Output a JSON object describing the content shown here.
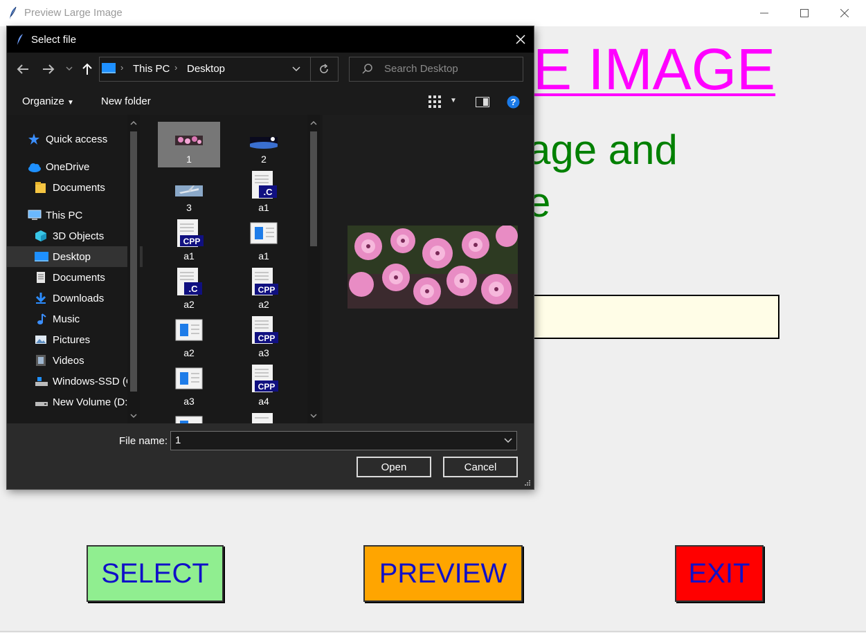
{
  "window": {
    "title": "Preview Large Image"
  },
  "main": {
    "heading": "E IMAGE",
    "subtitle_line1": "age and",
    "subtitle_line2": "e",
    "buttons": {
      "select": "SELECT",
      "preview": "PREVIEW",
      "exit": "EXIT"
    },
    "colors": {
      "heading": "#ff00ff",
      "subtitle": "#008000",
      "select_bg": "#90ee90",
      "preview_bg": "#ffa500",
      "exit_bg": "#ff0000",
      "button_text": "#1010c8",
      "entry_bg": "#fffde7"
    }
  },
  "dialog": {
    "title": "Select file",
    "breadcrumb": [
      "This PC",
      "Desktop"
    ],
    "search_placeholder": "Search Desktop",
    "toolbar": {
      "organize": "Organize",
      "new_folder": "New folder"
    },
    "nav_items": [
      {
        "label": "Quick access",
        "icon": "star-icon"
      },
      {
        "label": "OneDrive",
        "icon": "cloud-icon"
      },
      {
        "label": "Documents",
        "icon": "folder-icon"
      },
      {
        "label": "This PC",
        "icon": "computer-icon"
      },
      {
        "label": "3D Objects",
        "icon": "cube-icon"
      },
      {
        "label": "Desktop",
        "icon": "desktop-icon",
        "selected": true
      },
      {
        "label": "Documents",
        "icon": "document-icon"
      },
      {
        "label": "Downloads",
        "icon": "download-icon"
      },
      {
        "label": "Music",
        "icon": "music-icon"
      },
      {
        "label": "Pictures",
        "icon": "pictures-icon"
      },
      {
        "label": "Videos",
        "icon": "video-icon"
      },
      {
        "label": "Windows-SSD (C",
        "icon": "drive-icon"
      },
      {
        "label": "New Volume (D:",
        "icon": "drive-icon"
      }
    ],
    "files": [
      {
        "label": "1",
        "kind": "photo-flowers",
        "selected": true
      },
      {
        "label": "2",
        "kind": "photo-space"
      },
      {
        "label": "3",
        "kind": "photo-plane"
      },
      {
        "label": "a1",
        "kind": "c-file"
      },
      {
        "label": "a1",
        "kind": "cpp-file"
      },
      {
        "label": "a1",
        "kind": "exe-file"
      },
      {
        "label": "a2",
        "kind": "c-file"
      },
      {
        "label": "a2",
        "kind": "cpp-file"
      },
      {
        "label": "a2",
        "kind": "exe-file"
      },
      {
        "label": "a3",
        "kind": "cpp-file"
      },
      {
        "label": "a3",
        "kind": "exe-file"
      },
      {
        "label": "a4",
        "kind": "cpp-file"
      }
    ],
    "file_name_label": "File name:",
    "file_name_value": "1",
    "open_label": "Open",
    "cancel_label": "Cancel"
  }
}
